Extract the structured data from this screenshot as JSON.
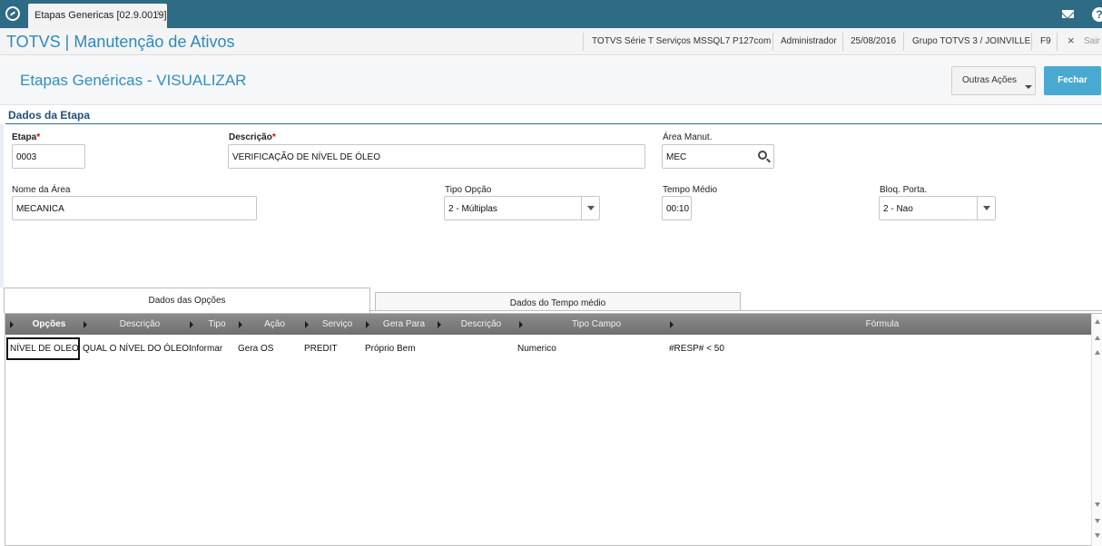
{
  "window": {
    "tab_title": "Etapas Genericas [02.9.0019]",
    "tab_close": "×",
    "help": "?"
  },
  "appbar": {
    "app_title": "TOTVS | Manutenção de Ativos",
    "environment": "TOTVS Série T Serviços MSSQL7 P127com",
    "user": "Administrador",
    "date": "25/08/2016",
    "group": "Grupo TOTVS 3 / JOINVILLE",
    "shortcut": "F9",
    "exit_icon": "×",
    "exit_label": "Sair"
  },
  "page": {
    "title": "Etapas Genéricas - VISUALIZAR",
    "other_actions_label": "Outras Ações",
    "close_label": "Fechar"
  },
  "section": {
    "title": "Dados da Etapa"
  },
  "form": {
    "etapa_label": "Etapa",
    "etapa_value": "0003",
    "descricao_label": "Descrição",
    "descricao_value": "VERIFICAÇÃO DE NÍVEL DE ÓLEO",
    "area_label": "Área Manut.",
    "area_value": "MEC",
    "nome_area_label": "Nome da Área",
    "nome_area_value": "MECANICA",
    "tipo_opcao_label": "Tipo Opção",
    "tipo_opcao_value": "2 - Múltiplas",
    "tempo_medio_label": "Tempo Médio",
    "tempo_medio_value": "00:10",
    "bloq_porta_label": "Bloq. Porta.",
    "bloq_porta_value": "2 - Nao",
    "required_mark": "*"
  },
  "tabs": [
    {
      "label": "Dados das Opções",
      "active": true
    },
    {
      "label": "Dados do Tempo médio",
      "active": false
    }
  ],
  "grid": {
    "columns": [
      "Opções",
      "Descrição",
      "Tipo",
      "Ação",
      "Serviço",
      "Gera Para",
      "Descrição",
      "Tipo Campo",
      "Fórmula"
    ],
    "rows": [
      {
        "opcoes": "NÍVEL DE OLEO",
        "descricao": "QUAL O NÍVEL DO ÓLEO",
        "tipo": "Informar",
        "acao": "Gera OS",
        "servico": "PREDIT",
        "gera_para": "Próprio Bem",
        "descricao2": "",
        "tipo_campo": "Numerico",
        "formula": "#RESP#  < 50"
      }
    ]
  },
  "colors": {
    "topbar": "#2e6b85",
    "accent": "#2c8bbd",
    "button_primary": "#4aa9d0"
  }
}
